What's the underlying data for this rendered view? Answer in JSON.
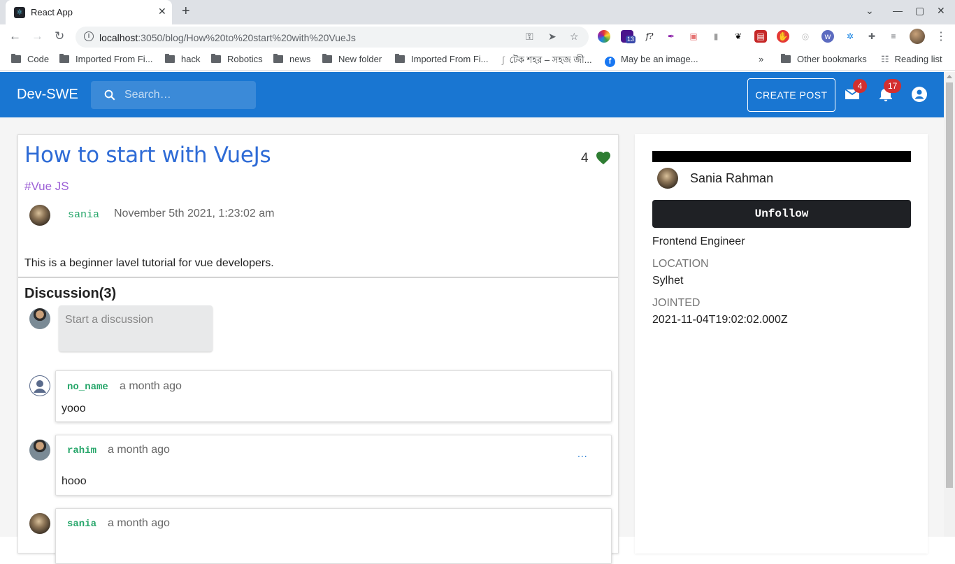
{
  "browser": {
    "tab_title": "React App",
    "url_host": "localhost",
    "url_rest": ":3050/blog/How%20to%20start%20with%20VueJs",
    "ext_badge": "13",
    "bookmarks": [
      {
        "label": "Code",
        "icon": "folder-icon"
      },
      {
        "label": "Imported From Fi...",
        "icon": "folder-icon"
      },
      {
        "label": "hack",
        "icon": "folder-icon"
      },
      {
        "label": "Robotics",
        "icon": "folder-icon"
      },
      {
        "label": "news",
        "icon": "folder-icon"
      },
      {
        "label": "New folder",
        "icon": "folder-icon"
      },
      {
        "label": "Imported From Fi...",
        "icon": "folder-icon"
      },
      {
        "label": "টেক শহর – সহজ জী...",
        "icon": "page-icon"
      },
      {
        "label": "May be an image...",
        "icon": "facebook-icon"
      },
      {
        "label": "Other bookmarks",
        "icon": "folder-icon"
      },
      {
        "label": "Reading list",
        "icon": "reading-list-icon"
      }
    ]
  },
  "app": {
    "brand": "Dev-SWE",
    "search_placeholder": "Search…",
    "create_post": "CREATE POST",
    "mail_count": "4",
    "notif_count": "17",
    "accent": "#1976d2"
  },
  "post": {
    "title": "How to start with VueJs",
    "likes": "4",
    "tag": "#Vue JS",
    "author": "sania",
    "date": "November 5th 2021, 1:23:02 am",
    "body": "This is a beginner lavel tutorial for vue developers."
  },
  "discussion": {
    "title": "Discussion(3)",
    "placeholder": "Start a discussion",
    "comments": [
      {
        "user": "no_name",
        "time": "a month ago",
        "text": "yooo"
      },
      {
        "user": "rahim",
        "time": "a month ago",
        "text": "hooo",
        "menu": "..."
      },
      {
        "user": "sania",
        "time": "a month ago",
        "text": ""
      }
    ]
  },
  "profile": {
    "name": "Sania Rahman",
    "unfollow": "Unfollow",
    "role": "Frontend Engineer",
    "location_label": "LOCATION",
    "location": "Sylhet",
    "joined_label": "JOINTED",
    "joined": "2021-11-04T19:02:02.000Z"
  }
}
